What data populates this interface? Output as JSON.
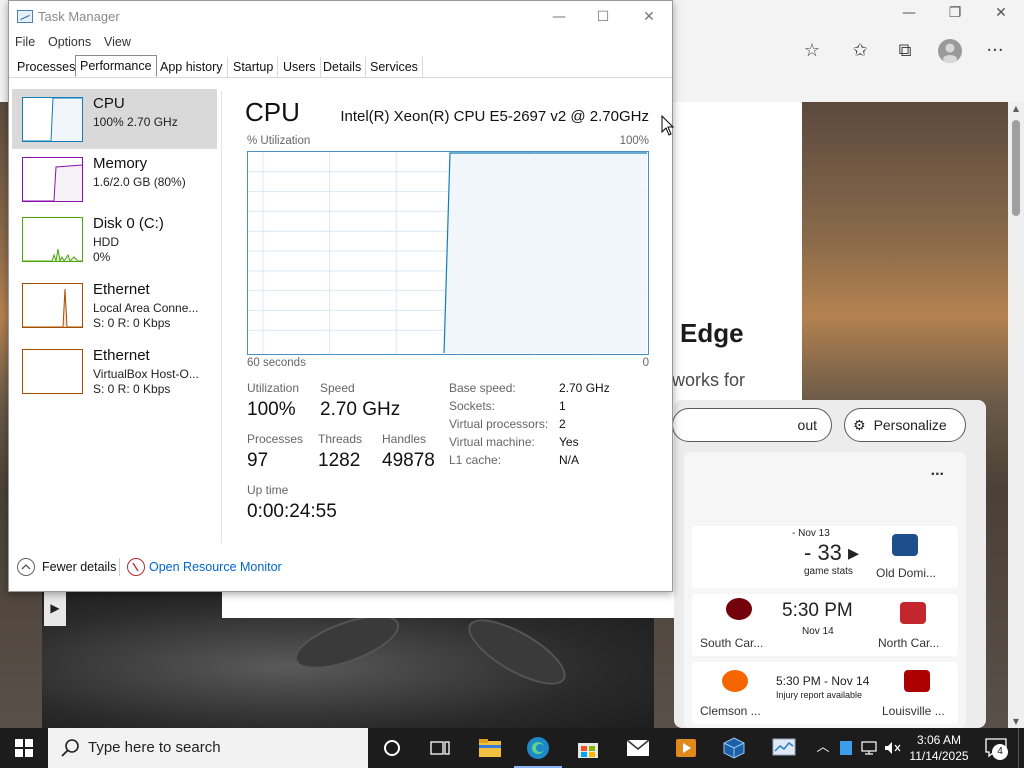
{
  "edge": {
    "minimize": "—",
    "restore": "❐",
    "close": "✕",
    "toolbar_icons": [
      "star-outline-icon",
      "favorites-icon",
      "collections-icon",
      "profile-icon",
      "more-icon"
    ],
    "heading": "Edge",
    "subtext": "works for",
    "btn_out": "out",
    "btn_personalize": "Personalize",
    "sports": {
      "more": "...",
      "rows": [
        {
          "left_team": "",
          "mid_line1": "- Nov 13",
          "mid_line2": "- 33 ▸",
          "mid_line3": "game stats",
          "right_team": "Old Domi..."
        },
        {
          "left_team": "South Car...",
          "mid_line1": "5:30 PM",
          "mid_line2": "Nov 14",
          "mid_line3": "",
          "right_team": "North Car..."
        },
        {
          "left_team": "Clemson ...",
          "mid_line1": "5:30 PM - Nov 14",
          "mid_line2": "Injury report available",
          "mid_line3": "",
          "right_team": "Louisville ..."
        }
      ]
    }
  },
  "task_manager": {
    "title": "Task Manager",
    "window_controls": {
      "minimize": "—",
      "maximize": "☐",
      "close": "✕"
    },
    "menu": [
      "File",
      "Options",
      "View"
    ],
    "tabs": [
      "Processes",
      "Performance",
      "App history",
      "Startup",
      "Users",
      "Details",
      "Services"
    ],
    "active_tab": "Performance",
    "resources": [
      {
        "name": "CPU",
        "line2": "100%  2.70 GHz",
        "line3": "",
        "color": "#117dbb"
      },
      {
        "name": "Memory",
        "line2": "1.6/2.0 GB (80%)",
        "line3": "",
        "color": "#8b12ae"
      },
      {
        "name": "Disk 0 (C:)",
        "line2": "HDD",
        "line3": "0%",
        "color": "#4da60c"
      },
      {
        "name": "Ethernet",
        "line2": "Local Area Conne...",
        "line3": "S: 0  R: 0 Kbps",
        "color": "#a74f01"
      },
      {
        "name": "Ethernet",
        "line2": "VirtualBox Host-O...",
        "line3": "S: 0  R: 0 Kbps",
        "color": "#a74f01"
      }
    ],
    "cpu": {
      "title": "CPU",
      "model": "Intel(R) Xeon(R) CPU E5-2697 v2 @ 2.70GHz",
      "graph_label_left": "% Utilization",
      "graph_label_right": "100%",
      "axis_left": "60 seconds",
      "axis_right": "0",
      "utilization_label": "Utilization",
      "utilization_value": "100%",
      "speed_label": "Speed",
      "speed_value": "2.70 GHz",
      "processes_label": "Processes",
      "processes_value": "97",
      "threads_label": "Threads",
      "threads_value": "1282",
      "handles_label": "Handles",
      "handles_value": "49878",
      "uptime_label": "Up time",
      "uptime_value": "0:00:24:55",
      "specs": [
        {
          "label": "Base speed:",
          "value": "2.70 GHz"
        },
        {
          "label": "Sockets:",
          "value": "1"
        },
        {
          "label": "Virtual processors:",
          "value": "2"
        },
        {
          "label": "Virtual machine:",
          "value": "Yes"
        },
        {
          "label": "L1 cache:",
          "value": "N/A"
        }
      ]
    },
    "footer": {
      "fewer_details": "Fewer details",
      "open_resource_monitor": "Open Resource Monitor"
    }
  },
  "taskbar": {
    "search_placeholder": "Type here to search",
    "clock_time": "3:06 AM",
    "clock_date": "11/14/2025",
    "notification_count": "4",
    "accent": "#0078d7"
  }
}
